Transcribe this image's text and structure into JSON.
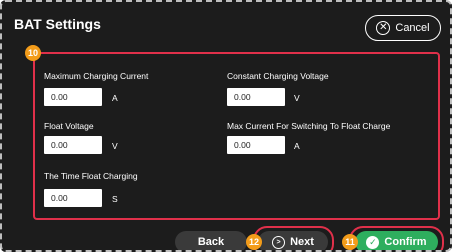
{
  "header": {
    "title": "BAT Settings",
    "cancel_label": "Cancel",
    "cancel_icon": "circle-x-icon"
  },
  "callouts": {
    "panel": "10",
    "confirm": "11",
    "next": "12"
  },
  "fields": [
    {
      "label": "Maximum Charging Current",
      "value": "0.00",
      "unit": "A"
    },
    {
      "label": "Constant Charging Voltage",
      "value": "0.00",
      "unit": "V"
    },
    {
      "label": "Float Voltage",
      "value": "0.00",
      "unit": "V"
    },
    {
      "label": "Max Current For Switching To Float Charge",
      "value": "0.00",
      "unit": "A"
    },
    {
      "label": "The Time Float Charging",
      "value": "0.00",
      "unit": "S"
    }
  ],
  "footer": {
    "back_label": "Back",
    "next_label": "Next",
    "next_icon": "circle-chevron-right-icon",
    "confirm_label": "Confirm",
    "confirm_icon": "check-circle-icon"
  },
  "colors": {
    "background": "#1c1c1c",
    "highlight": "#e0304a",
    "callout": "#f39c1a",
    "confirm": "#2eae5e",
    "button": "#3a3a3a"
  }
}
